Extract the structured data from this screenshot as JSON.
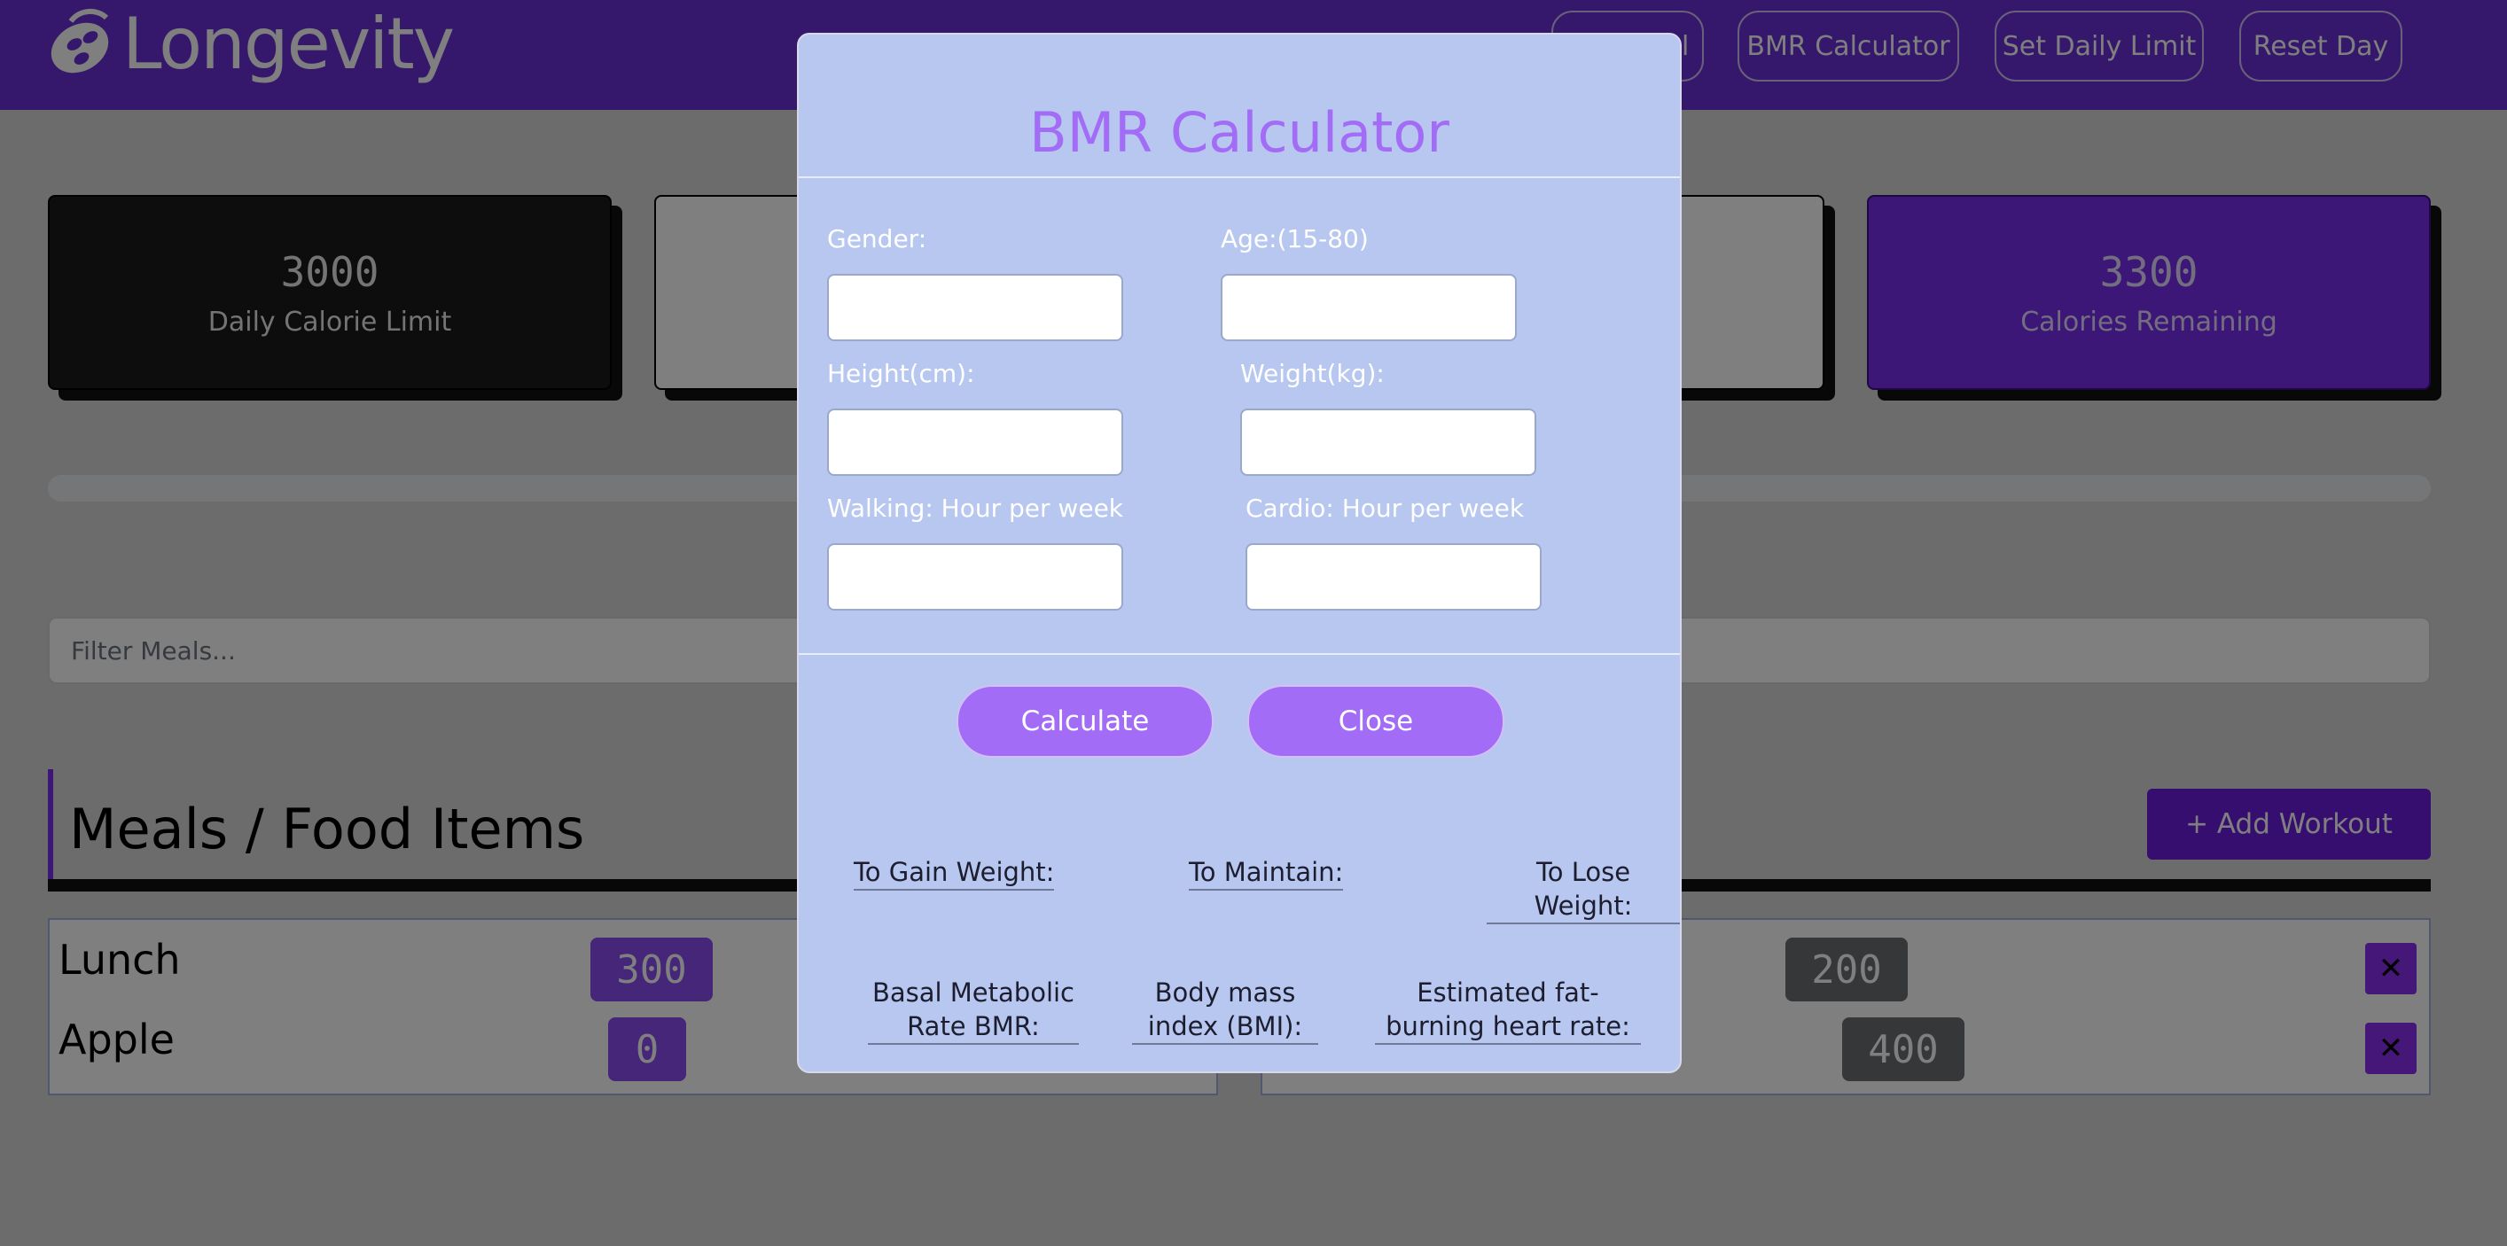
{
  "app": {
    "brand": "Longevity",
    "nav": [
      "Add Meal",
      "BMR Calculator",
      "Set Daily Limit",
      "Reset Day"
    ]
  },
  "stats": [
    {
      "value": "3000",
      "label": "Daily Calorie Limit"
    },
    {
      "value": "",
      "label": ""
    },
    {
      "value": "",
      "label": ""
    },
    {
      "value": "3300",
      "label": "Calories Remaining"
    }
  ],
  "filter": {
    "placeholder": "Filter Meals..."
  },
  "meals_section": {
    "title": "Meals / Food Items",
    "add_workout": "+ Add Workout"
  },
  "meals": [
    {
      "name": "Lunch",
      "calories": "300"
    },
    {
      "name": "Apple",
      "calories": "0"
    }
  ],
  "workouts": [
    {
      "calories": "200"
    },
    {
      "calories": "400"
    }
  ],
  "delete_glyph": "✕",
  "modal": {
    "title": "BMR Calculator",
    "fields": {
      "gender": "Gender:",
      "age": "Age:(15-80)",
      "height": "Height(cm):",
      "weight": "Weight(kg):",
      "walking": "Walking: Hour per week",
      "cardio": "Cardio: Hour per week"
    },
    "calculate": "Calculate",
    "close": "Close",
    "results": {
      "gain": "To Gain Weight:",
      "maintain": "To Maintain:",
      "lose": "To Lose Weight:",
      "bmr": "Basal Metabolic Rate BMR:",
      "bmi": "Body mass index (BMI):",
      "fat_burn": "Estimated fat-burning heart rate:"
    }
  },
  "colors": {
    "header": "#6a31d8",
    "accent": "#a36cf6",
    "modal_bg": "#b7c7ef",
    "badge_purple": "#8a4df2",
    "badge_dark": "#6d6e70"
  }
}
